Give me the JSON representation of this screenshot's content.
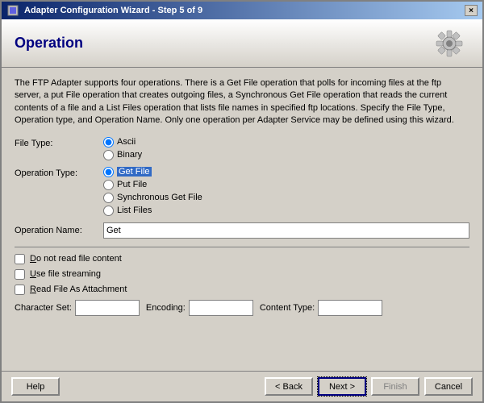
{
  "window": {
    "title": "Adapter Configuration Wizard - Step 5 of 9",
    "close_label": "×"
  },
  "header": {
    "title": "Operation"
  },
  "description": "The FTP Adapter supports four operations.  There is a Get File operation that polls for incoming files at the ftp server, a put File operation that creates outgoing files, a Synchronous Get File operation that reads the current contents of a file and a List Files operation that lists file names in specified ftp locations.  Specify the File Type, Operation type, and Operation Name.  Only one operation per Adapter Service may be defined using this wizard.",
  "file_type": {
    "label": "File Type:",
    "options": [
      {
        "id": "ascii",
        "label": "Ascii",
        "checked": true
      },
      {
        "id": "binary",
        "label": "Binary",
        "checked": false
      }
    ]
  },
  "operation_type": {
    "label": "Operation Type:",
    "options": [
      {
        "id": "get_file",
        "label": "Get File",
        "checked": true,
        "highlighted": true
      },
      {
        "id": "put_file",
        "label": "Put File",
        "checked": false
      },
      {
        "id": "sync_get_file",
        "label": "Synchronous Get File",
        "checked": false
      },
      {
        "id": "list_files",
        "label": "List Files",
        "checked": false
      }
    ]
  },
  "operation_name": {
    "label": "Operation Name:",
    "value": "Get"
  },
  "checkboxes": [
    {
      "id": "no_read_content",
      "label": "Do not read file content",
      "checked": false
    },
    {
      "id": "file_streaming",
      "label": "Use file streaming",
      "checked": false
    },
    {
      "id": "read_as_attachment",
      "label": "Read File As Attachment",
      "checked": false
    }
  ],
  "bottom_fields": [
    {
      "id": "character_set",
      "label": "Character Set:",
      "value": "",
      "width": 80
    },
    {
      "id": "encoding",
      "label": "Encoding:",
      "value": "",
      "width": 80
    },
    {
      "id": "content_type",
      "label": "Content Type:",
      "value": "",
      "width": 80
    }
  ],
  "footer": {
    "help_label": "Help",
    "back_label": "< Back",
    "next_label": "Next >",
    "finish_label": "Finish",
    "cancel_label": "Cancel"
  }
}
